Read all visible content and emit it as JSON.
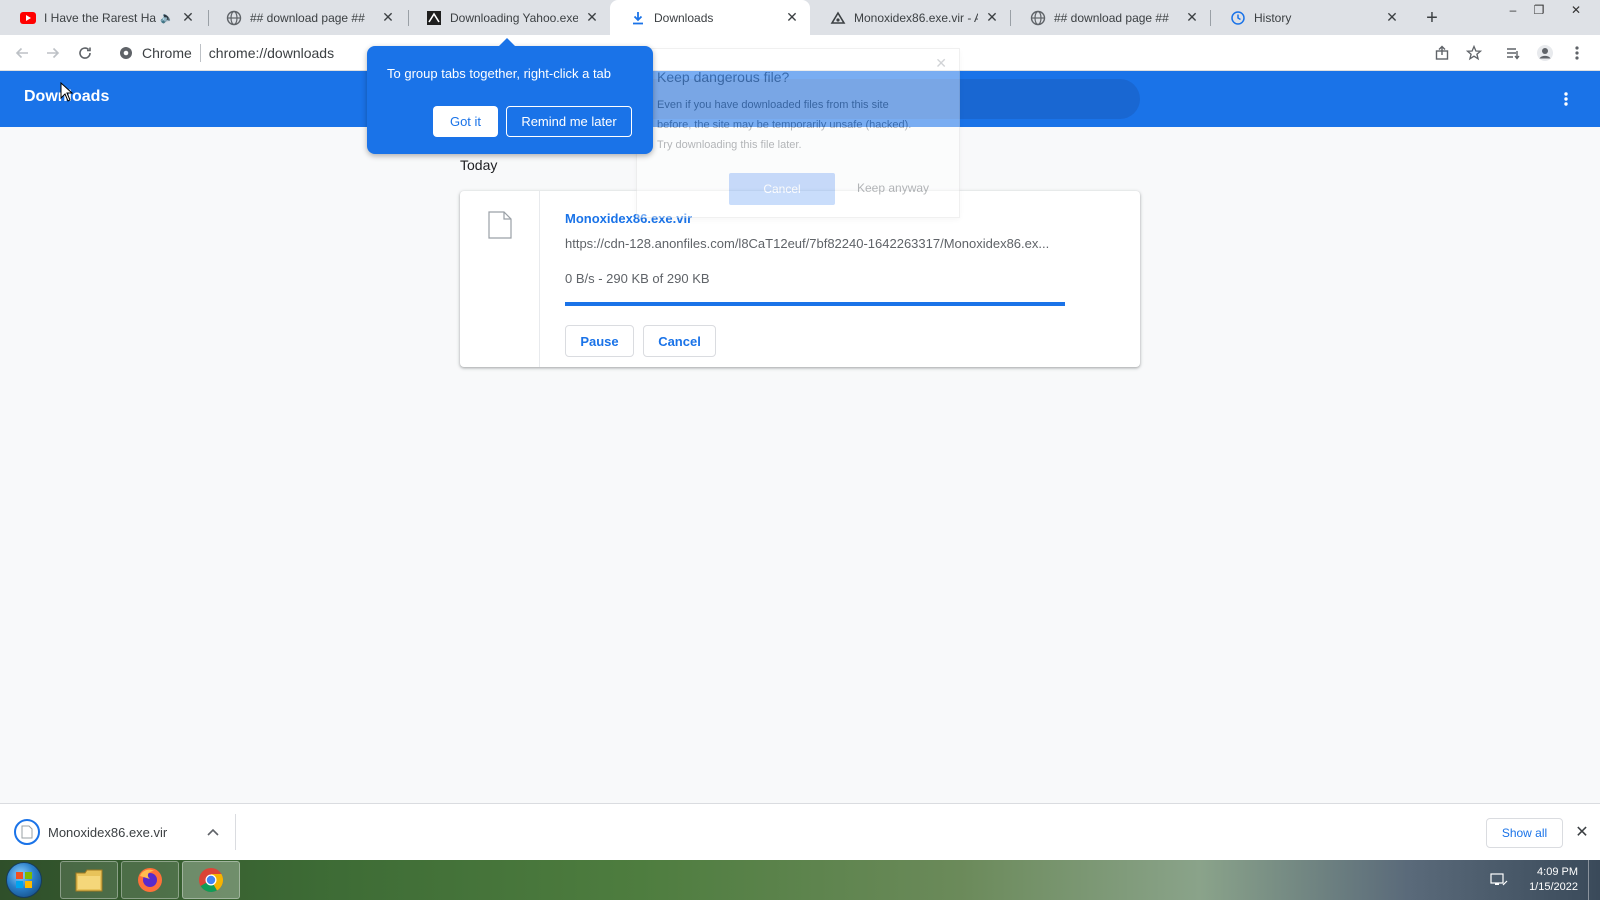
{
  "tabs": [
    {
      "title": "I Have the Rarest Har",
      "icon": "youtube-icon",
      "muted": true
    },
    {
      "title": "## download page ##",
      "icon": "globe-icon"
    },
    {
      "title": "Downloading Yahoo.exe",
      "icon": "site-icon"
    },
    {
      "title": "Downloads",
      "icon": "download-icon",
      "active": true
    },
    {
      "title": "Monoxidex86.exe.vir - An",
      "icon": "site-icon"
    },
    {
      "title": "## download page ##",
      "icon": "globe-icon"
    },
    {
      "title": "History",
      "icon": "history-icon"
    }
  ],
  "omnibox": {
    "scheme_label": "Chrome",
    "url": "chrome://downloads"
  },
  "page": {
    "title": "Downloads"
  },
  "bubble": {
    "text": "To group tabs together, right-click a tab",
    "got_it": "Got it",
    "remind": "Remind me later"
  },
  "ghost_dialog": {
    "title": "Keep dangerous file?",
    "line1": "Even if you have downloaded files from this site",
    "line2": "before, the site may be temporarily unsafe (hacked).",
    "line3": "Try downloading this file later.",
    "cancel": "Cancel",
    "keep": "Keep anyway"
  },
  "downloads": {
    "section": "Today",
    "item": {
      "name": "Monoxidex86.exe.vir",
      "url": "https://cdn-128.anonfiles.com/l8CaT12euf/7bf82240-1642263317/Monoxidex86.ex...",
      "status": "0 B/s - 290 KB of 290 KB",
      "progress": 1.0,
      "pause_label": "Pause",
      "cancel_label": "Cancel"
    }
  },
  "shelf": {
    "item_name": "Monoxidex86.exe.vir",
    "show_all": "Show all"
  },
  "taskbar": {
    "time": "4:09 PM",
    "date": "1/15/2022"
  },
  "colors": {
    "accent": "#1a73e8",
    "header": "#1a73e8",
    "tabstrip": "#dee1e6"
  }
}
